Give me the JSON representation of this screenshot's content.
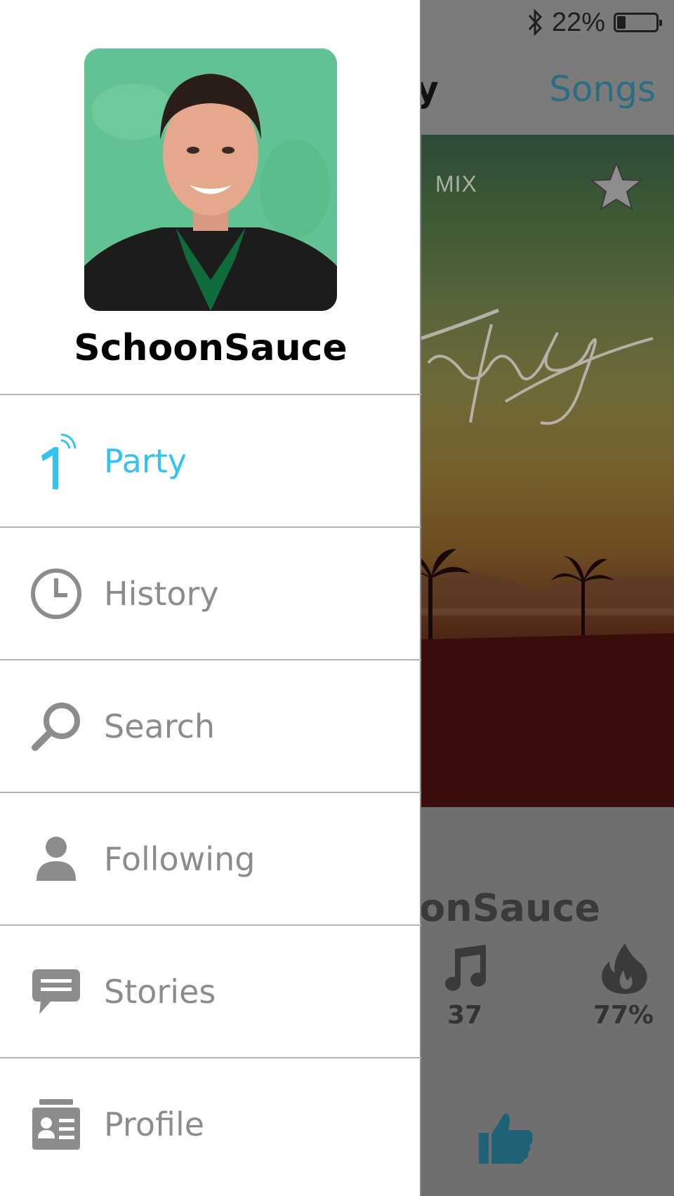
{
  "status_bar": {
    "battery_text": "22%",
    "battery_level": 0.22,
    "bluetooth_icon": "bluetooth-icon"
  },
  "background": {
    "title_fragment": "ay",
    "songs_label": "Songs",
    "album_mix_text": "MIX",
    "username_fragment": "oonSauce",
    "songs_count": "37",
    "fire_percent": "77%"
  },
  "drawer": {
    "username": "SchoonSauce",
    "menu": [
      {
        "label": "Party",
        "icon": "party-icon",
        "active": true
      },
      {
        "label": "History",
        "icon": "clock-icon",
        "active": false
      },
      {
        "label": "Search",
        "icon": "search-icon",
        "active": false
      },
      {
        "label": "Following",
        "icon": "person-icon",
        "active": false
      },
      {
        "label": "Stories",
        "icon": "chat-bubble-icon",
        "active": false
      },
      {
        "label": "Profile",
        "icon": "id-card-icon",
        "active": false
      }
    ]
  },
  "colors": {
    "accent": "#34c3f0",
    "menu_text": "#8c8c8c",
    "divider": "#b5b5b5",
    "link_dim": "#2a6d84"
  }
}
